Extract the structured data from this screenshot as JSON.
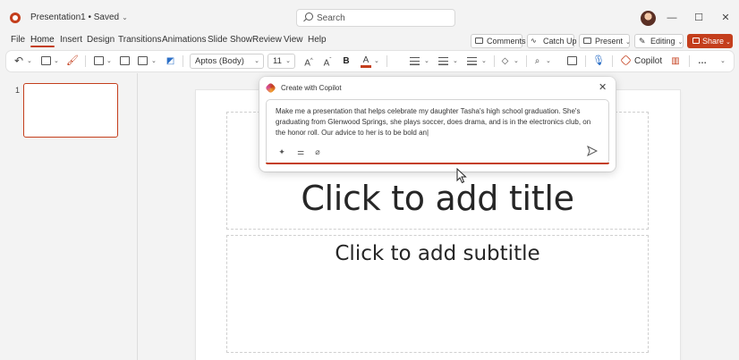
{
  "titlebar": {
    "doc_title": "Presentation1 • Saved",
    "search_placeholder": "Search"
  },
  "menu": {
    "items": [
      "File",
      "Home",
      "Insert",
      "Design",
      "Transitions",
      "Animations",
      "Slide Show",
      "Review",
      "View",
      "Help"
    ],
    "active": "Home",
    "comments": "Comments",
    "catch_up": "Catch Up",
    "present": "Present",
    "editing": "Editing",
    "share": "Share"
  },
  "ribbon": {
    "font_name": "Aptos (Body)",
    "font_size": "11",
    "bold": "B",
    "font_color_letter": "A",
    "copilot": "Copilot",
    "more": "…",
    "accent_color": "#c43e1c"
  },
  "thumbnails": [
    {
      "number": "1"
    }
  ],
  "slide": {
    "title_placeholder": "Click to add title",
    "subtitle_placeholder": "Click to add subtitle"
  },
  "copilot_dialog": {
    "title": "Create with Copilot",
    "prompt": "Make me a presentation that helps celebrate my daughter Tasha's high school graduation. She's graduating from Glenwood Springs, she plays soccer, does drama, and is in the electronics club, on the honor roll. Our advice to her is to be bold an|"
  },
  "icons": {
    "accent": "#c43e1c"
  }
}
